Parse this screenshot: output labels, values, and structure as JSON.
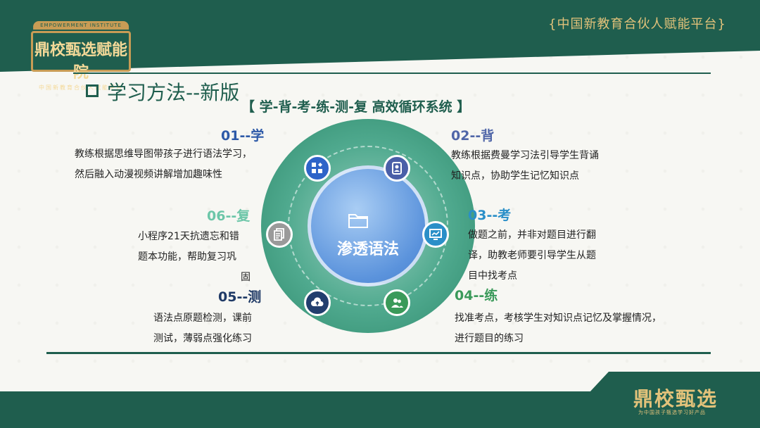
{
  "header": {
    "slogan": "{中国新教育合伙人赋能平台}",
    "logo_top": "EMPOWERMENT INSTITUTE",
    "logo_main": "鼎校甄选赋能院",
    "logo_sub": "中国新教育合伙人赋能平台"
  },
  "title": "学习方法--新版",
  "subtitle": "【 学-背-考-练-测-复 高效循环系统 】",
  "center": {
    "label": "渗透语法"
  },
  "steps": [
    {
      "heading": "01--学",
      "lines": [
        "教练根据思维导图带孩子进行语法学习，",
        "然后融入动漫视频讲解增加趣味性"
      ]
    },
    {
      "heading": "02--背",
      "lines": [
        "教练根据费曼学习法引导学生背诵",
        "知识点，协助学生记忆知识点"
      ]
    },
    {
      "heading": "03--考",
      "lines": [
        "做题之前，并非对题目进行翻",
        "译，助教老师要引导学生从题",
        "目中找考点"
      ]
    },
    {
      "heading": "04--练",
      "lines": [
        "找准考点，考核学生对知识点记忆及掌握情况，",
        "进行题目的练习"
      ]
    },
    {
      "heading": "05--测",
      "lines": [
        "语法点原题检测，课前",
        "测试，薄弱点强化练习"
      ]
    },
    {
      "heading": "06--复",
      "lines": [
        "小程序21天抗遗忘和错",
        "题本功能，帮助复习巩",
        "固"
      ]
    }
  ],
  "colors": {
    "brand_green": "#1f5e4e",
    "gold": "#e2c27a",
    "step1": "#2e5aa8",
    "step2": "#5066a8",
    "step3": "#2a8fc8",
    "step4": "#3a9a5a",
    "step5": "#1f3a66",
    "step6": "#6cc6a8"
  },
  "footer": {
    "brand": "鼎校甄选",
    "brand_sub": "为中国孩子甄选学习好产品"
  }
}
